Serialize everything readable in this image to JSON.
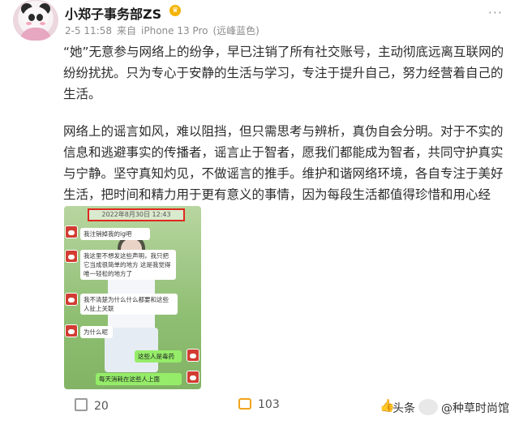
{
  "header": {
    "username": "小郑子事务部ZS",
    "meta": {
      "date": "2-5 11:58",
      "source_prefix": "来自",
      "device": "iPhone 13 Pro",
      "location": "(远峰蓝色)"
    },
    "more_label": "···"
  },
  "post": {
    "paragraph1": "“她”无意参与网络上的纷争，早已注销了所有社交账号，主动彻底远离互联网的纷纷扰扰。只为专心于安静的生活与学习，专注于提升自己，努力经营着自己的生活。",
    "paragraph2": "网络上的谣言如风，难以阻挡，但只需思考与辨析，真伪自会分明。对于不实的信息和逃避事实的传播者，谣言止于智者，愿我们都能成为智者，共同守护真实与宁静。坚守真知灼见，不做谣言的推手。维护和谐网络环境，各自专注于美好生活，把时间和精力用于更有意义的事情，因为每段生活都值得珍惜和用心经营。",
    "collapse_label": "收起"
  },
  "chat": {
    "date": "2022年8月30日 12:43",
    "messages": [
      "我注销掉我的ig吧",
      "我这里不想发这些声明，我只把它当成很简单的地方 这是我觉得唯一轻松的地方了",
      "我不清楚为什么什么都要和这些人扯上关联",
      "为什么呢",
      "这些人是毒药",
      "每天消耗在这些人上面"
    ]
  },
  "actions": {
    "share_count": "20",
    "comment_count": "103",
    "like_count": ""
  },
  "watermark": {
    "platform": "头条",
    "account": "@种草时尚馆"
  },
  "colors": {
    "accent": "#eb7350",
    "chat_green": "#95ec69",
    "comment": "#f0a41c"
  }
}
